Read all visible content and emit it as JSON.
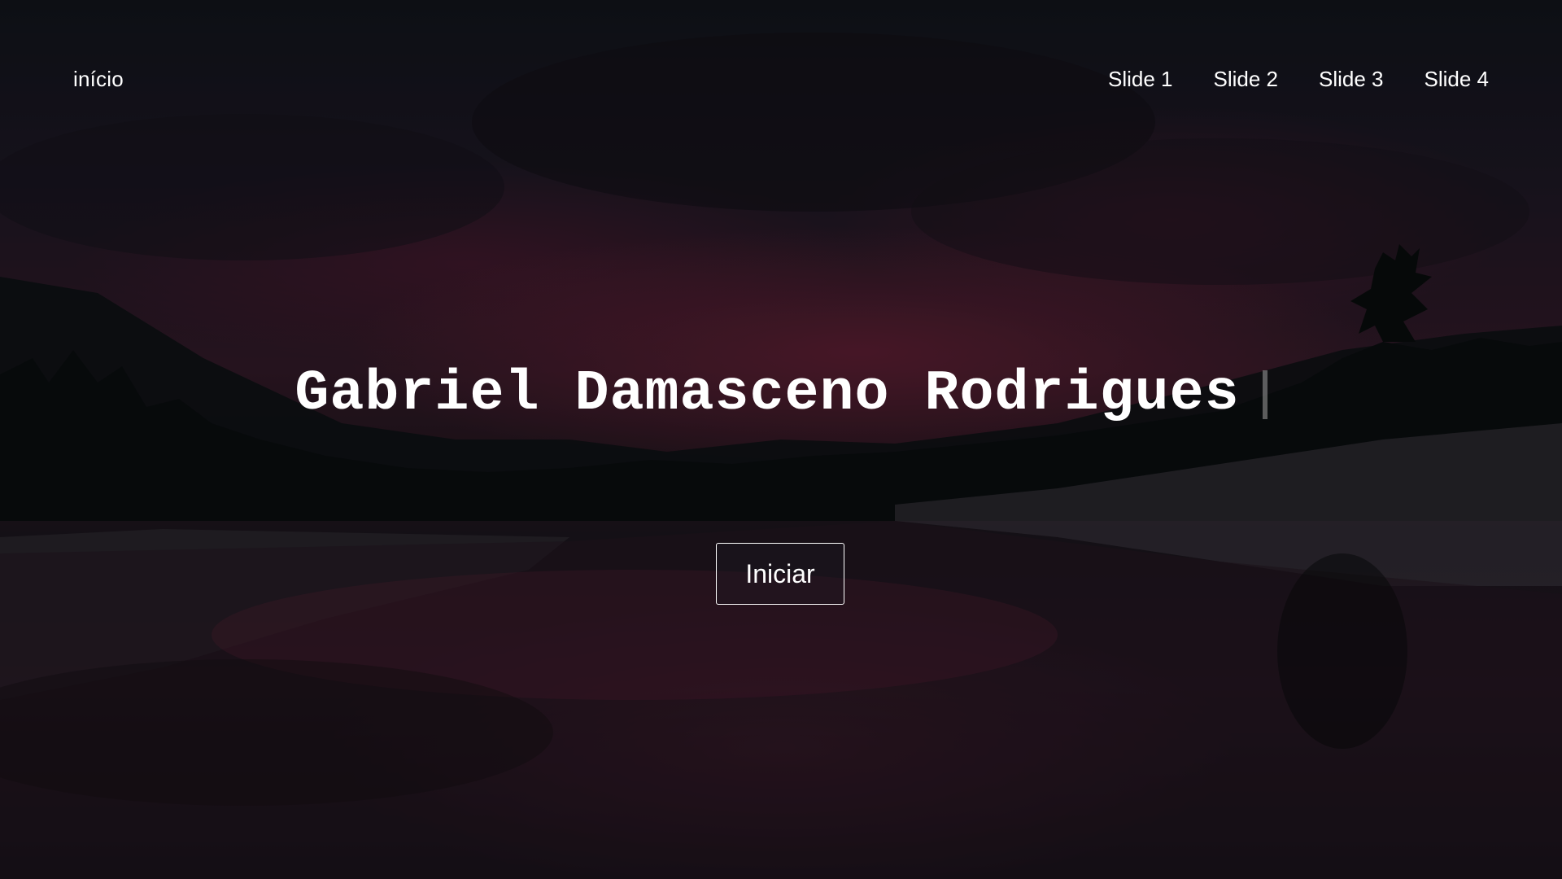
{
  "nav": {
    "brand": "início",
    "links": [
      "Slide 1",
      "Slide 2",
      "Slide 3",
      "Slide 4"
    ]
  },
  "hero": {
    "title": "Gabriel Damasceno Rodrigues",
    "button_label": "Iniciar"
  },
  "colors": {
    "text": "#ffffff",
    "accent_sky": "#3a1e2e",
    "overlay": "rgba(0,0,0,0.35)"
  }
}
